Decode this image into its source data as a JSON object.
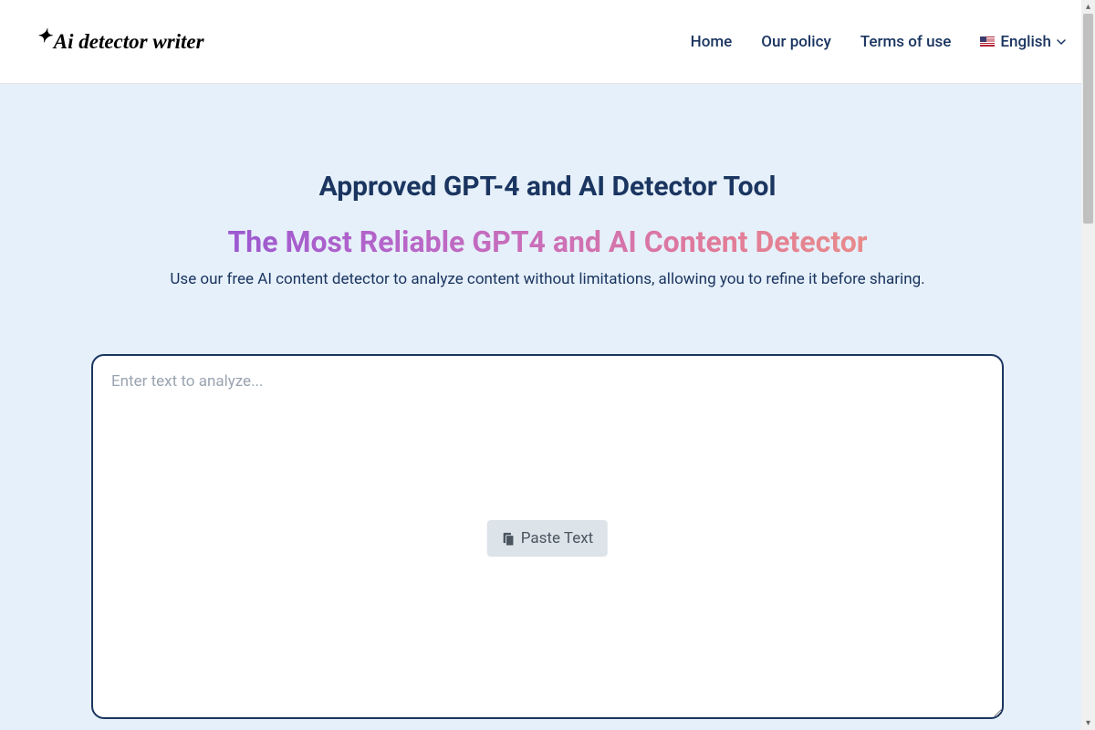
{
  "header": {
    "logo_text": "Ai detector writer",
    "nav": {
      "home": "Home",
      "policy": "Our policy",
      "terms": "Terms of use"
    },
    "language": {
      "label": "English"
    }
  },
  "main": {
    "title_small": "Approved GPT-4 and AI Detector Tool",
    "title_large": "The Most Reliable GPT4 and AI Content Detector",
    "subtitle": "Use our free AI content detector to analyze content without limitations, allowing you to refine it before sharing.",
    "textarea": {
      "placeholder": "Enter text to analyze...",
      "value": ""
    },
    "paste_button": "Paste Text"
  }
}
